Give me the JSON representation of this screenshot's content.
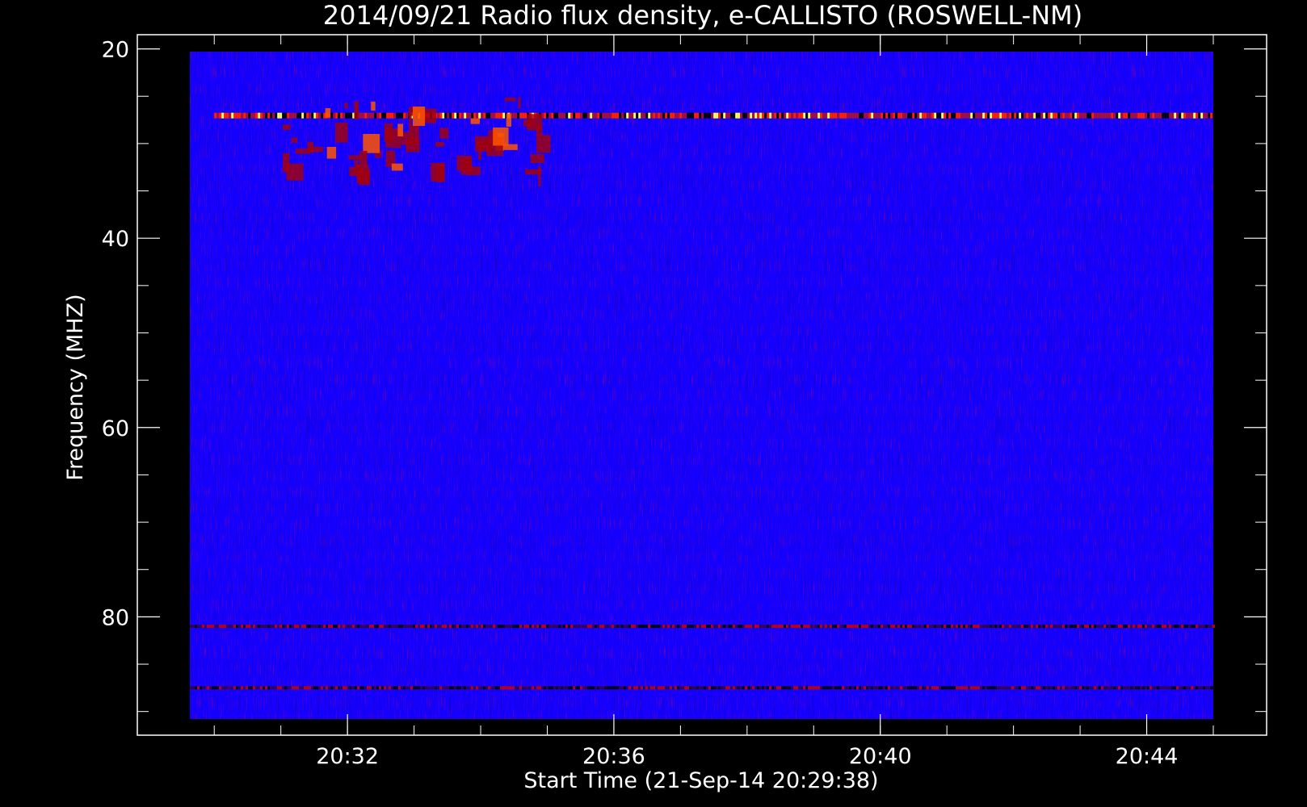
{
  "chart_data": {
    "type": "heatmap",
    "title": "2014/09/21  Radio flux density, e-CALLISTO (ROSWELL-NM)",
    "xlabel": "Start Time (21-Sep-14 20:29:38)",
    "ylabel": "Frequency (MHZ)",
    "x_unit": "UT time",
    "xlim": [
      "20:29:38",
      "20:45:00"
    ],
    "ylim": [
      92.5,
      18.5
    ],
    "y_inverted": true,
    "x_ticks": [
      "20:32",
      "20:36",
      "20:40",
      "20:44"
    ],
    "y_ticks": [
      20,
      40,
      60,
      80
    ],
    "data_extent": {
      "time": [
        "20:29:38",
        "20:45:00"
      ],
      "frequency_mhz": [
        20.0,
        92.5
      ]
    },
    "colormap": [
      "#000000",
      "#0000ff",
      "#ff0000",
      "#ffff00",
      "#ffffff"
    ],
    "background_color": "#1400ff",
    "features": [
      {
        "label": "strong emission band",
        "frequency_mhz": 27,
        "time": [
          "20:30:00",
          "20:45:00"
        ]
      },
      {
        "label": "bursts",
        "frequency_mhz": [
          25,
          33
        ],
        "time": [
          "20:31:00",
          "20:35:00"
        ]
      },
      {
        "label": "interference band",
        "frequency_mhz": 81,
        "time": [
          "20:29:38",
          "20:45:00"
        ]
      },
      {
        "label": "interference band",
        "frequency_mhz": 87.5,
        "time": [
          "20:29:38",
          "20:45:00"
        ]
      }
    ]
  }
}
